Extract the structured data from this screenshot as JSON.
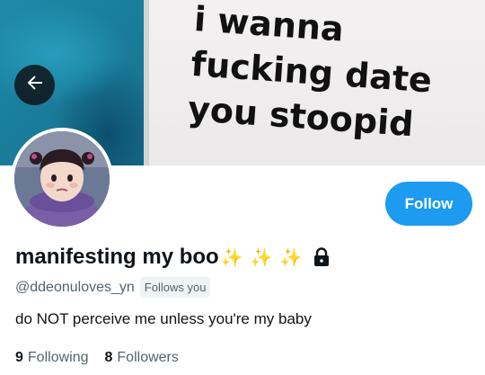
{
  "banner": {
    "text_lines": [
      "i wanna",
      "fucking date",
      "you stoopid"
    ]
  },
  "profile": {
    "display_name": "manifesting my boo",
    "sparkles": [
      "✨",
      "✨",
      "✨"
    ],
    "handle": "@ddeonuloves_yn",
    "follows_you_label": "Follows you",
    "bio": "do NOT perceive me unless you're my baby",
    "following_count": "9",
    "following_label": "Following",
    "followers_count": "8",
    "followers_label": "Followers"
  },
  "actions": {
    "follow_label": "Follow"
  },
  "icons": {
    "back": "arrow-left-icon",
    "lock": "lock-icon"
  },
  "colors": {
    "accent": "#1d9bf0",
    "text_primary": "#0f1419",
    "text_secondary": "#536471"
  }
}
